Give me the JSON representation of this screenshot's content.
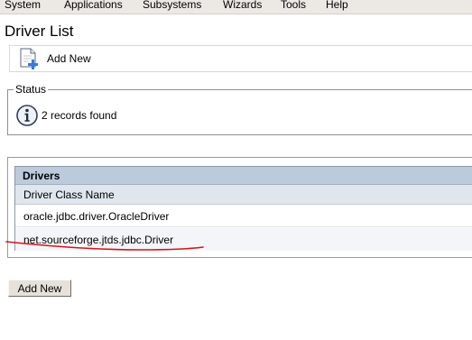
{
  "menubar": {
    "items": [
      "System",
      "Applications",
      "Subsystems",
      "Wizards",
      "Tools",
      "Help"
    ]
  },
  "page": {
    "title": "Driver List"
  },
  "toolbar": {
    "add_new_label": "Add New",
    "add_new_icon": "add-document-icon"
  },
  "status": {
    "legend": "Status",
    "icon": "info-icon",
    "message": "2 records found"
  },
  "drivers": {
    "title": "Drivers",
    "columns": [
      "Driver Class Name"
    ],
    "rows": [
      {
        "driver_class_name": "oracle.jdbc.driver.OracleDriver"
      },
      {
        "driver_class_name": "net.sourceforge.jtds.jdbc.Driver"
      }
    ]
  },
  "footer": {
    "add_new_button_label": "Add New"
  },
  "colors": {
    "menubar_bg": "#ece9e4",
    "table_header_bg": "#bccbdc",
    "column_header_bg": "#dfe6ee",
    "annotation_stroke": "#d6141d"
  }
}
